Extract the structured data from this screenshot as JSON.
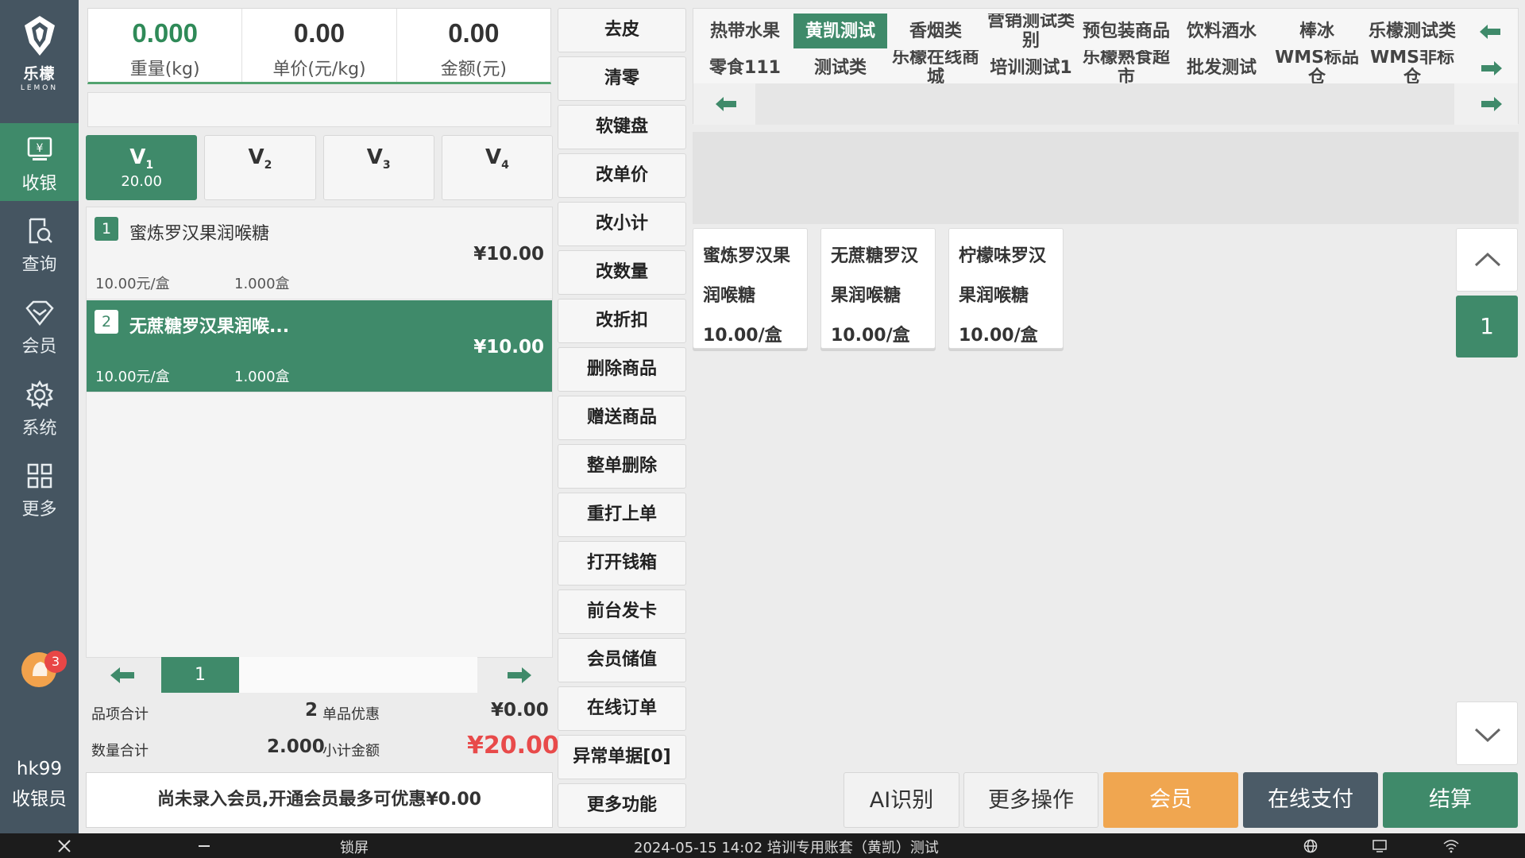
{
  "app": {
    "logo_cn": "乐檬",
    "logo_en": "LEMON"
  },
  "nav": {
    "items": [
      {
        "label": "收银",
        "icon": "cashier-icon",
        "active": true
      },
      {
        "label": "查询",
        "icon": "search-doc-icon",
        "active": false
      },
      {
        "label": "会员",
        "icon": "diamond-icon",
        "active": false
      },
      {
        "label": "系统",
        "icon": "gear-icon",
        "active": false
      },
      {
        "label": "更多",
        "icon": "grid-icon",
        "active": false
      }
    ],
    "notification_count": "3",
    "user_name": "hk99",
    "user_role": "收银员"
  },
  "scale": {
    "weight_value": "0.000",
    "weight_label": "重量(kg)",
    "unit_price_value": "0.00",
    "unit_price_label": "单价(元/kg)",
    "amount_value": "0.00",
    "amount_label": "金额(元)"
  },
  "barcode_input": {
    "value": "",
    "placeholder": ""
  },
  "vtabs": [
    {
      "name": "V",
      "sub": "1",
      "amount": "20.00",
      "active": true
    },
    {
      "name": "V",
      "sub": "2",
      "amount": "",
      "active": false
    },
    {
      "name": "V",
      "sub": "3",
      "amount": "",
      "active": false
    },
    {
      "name": "V",
      "sub": "4",
      "amount": "",
      "active": false
    }
  ],
  "order_items": [
    {
      "num": "1",
      "name": "蜜炼罗汉果润喉糖",
      "price": "¥10.00",
      "unit_price": "10.00元/盒",
      "qty": "1.000盒",
      "selected": false
    },
    {
      "num": "2",
      "name": "无蔗糖罗汉果润喉...",
      "price": "¥10.00",
      "unit_price": "10.00元/盒",
      "qty": "1.000盒",
      "selected": true
    }
  ],
  "order_pager": {
    "page": "1"
  },
  "totals": {
    "item_count_label": "品项合计",
    "item_count_value": "2",
    "single_discount_label": "单品优惠",
    "single_discount_value": "¥0.00",
    "qty_total_label": "数量合计",
    "qty_total_value": "2.000",
    "subtotal_label": "小计金额",
    "subtotal_value": "¥20.00"
  },
  "member_note": "尚未录入会员,开通会员最多可优惠¥0.00",
  "functions": [
    "去皮",
    "清零",
    "软键盘",
    "改单价",
    "改小计",
    "改数量",
    "改折扣",
    "删除商品",
    "赠送商品",
    "整单删除",
    "重打上单",
    "打开钱箱",
    "前台发卡",
    "会员储值",
    "在线订单",
    "异常单据[0]",
    "更多功能"
  ],
  "categories": {
    "row1": [
      "热带水果",
      "黄凯测试",
      "香烟类",
      "营销测试类别",
      "预包装商品",
      "饮料酒水",
      "棒冰",
      "乐檬测试类"
    ],
    "row2": [
      "零食111",
      "测试类",
      "乐檬在线商城",
      "培训测试1",
      "乐檬熟食超市",
      "批发测试",
      "WMS标品仓",
      "WMS非标仓"
    ],
    "active": "黄凯测试"
  },
  "products": [
    {
      "name_line1": "蜜炼罗汉果",
      "name_line2": "润喉糖",
      "price": "10.00/盒"
    },
    {
      "name_line1": "无蔗糖罗汉",
      "name_line2": "果润喉糖",
      "price": "10.00/盒"
    },
    {
      "name_line1": "柠檬味罗汉",
      "name_line2": "果润喉糖",
      "price": "10.00/盒"
    }
  ],
  "product_pager": {
    "page": "1"
  },
  "actions": {
    "ai": "AI识别",
    "more_ops": "更多操作",
    "member": "会员",
    "online_pay": "在线支付",
    "checkout": "结算"
  },
  "colors": {
    "primary_green": "#3f8a6a",
    "nav_bg": "#455561",
    "member_orange": "#f0a650",
    "online_pay_slate": "#4b5b67",
    "subtotal_red": "#e84a4a"
  },
  "statusbar": {
    "lock": "锁屏",
    "info": "2024-05-15 14:02 培训专用账套（黄凯）测试"
  }
}
